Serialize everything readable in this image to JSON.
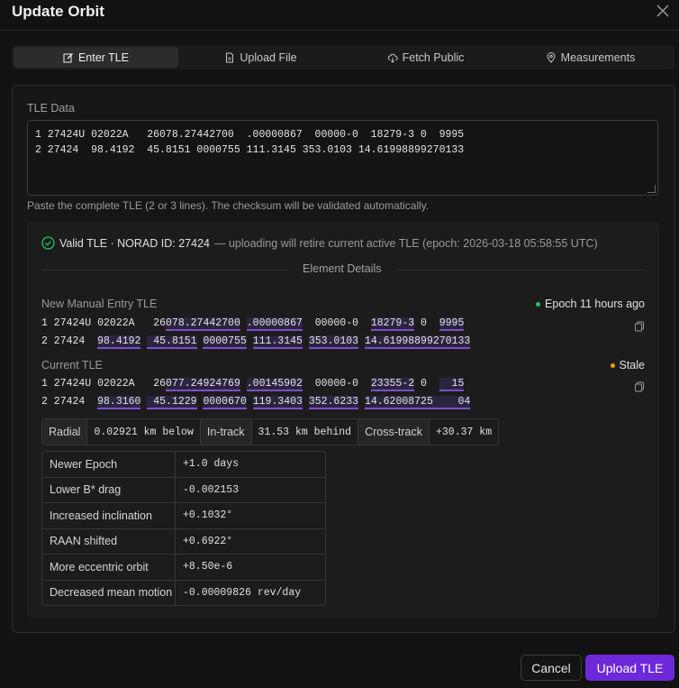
{
  "dialog": {
    "title": "Update Orbit"
  },
  "tabs": [
    {
      "label": "Enter TLE",
      "icon": "edit-icon"
    },
    {
      "label": "Upload File",
      "icon": "file-icon"
    },
    {
      "label": "Fetch Public",
      "icon": "cloud-download-icon"
    },
    {
      "label": "Measurements",
      "icon": "map-pin-icon"
    }
  ],
  "tle_input": {
    "label": "TLE Data",
    "line1": "1 27424U 02022A   26078.27442700  .00000867  00000-0  18279-3 0  9995",
    "line2": "2 27424  98.4192  45.8151 0000755 111.3145 353.0103 14.61998899270133",
    "helper": "Paste the complete TLE (2 or 3 lines). The checksum will be validated automatically."
  },
  "validation": {
    "status": "Valid TLE · NORAD ID: 27424",
    "detail": "— uploading will retire current active TLE (epoch: 2026-03-18 05:58:55 UTC)"
  },
  "element_details": {
    "title": "Element Details",
    "new": {
      "label": "New Manual Entry TLE",
      "status": "Epoch 11 hours ago",
      "status_color": "#22c55e",
      "line1_parts": [
        "1 27424U 02022A   26",
        "078.27442700",
        " ",
        ".00000867",
        "  00000-0  ",
        "18279-3",
        " 0  ",
        "9995"
      ],
      "line2_parts": [
        "2 27424  ",
        "98.4192",
        " ",
        " 45.8151",
        " ",
        "0000755",
        " ",
        "111.3145",
        " ",
        "353.0103",
        " ",
        "14.61998899270133"
      ]
    },
    "current": {
      "label": "Current TLE",
      "status": "Stale",
      "status_color": "#f59e0b",
      "line1_parts": [
        "1 27424U 02022A   26",
        "077.24924769",
        " ",
        ".00145902",
        "  00000-0  ",
        "23355-2",
        " 0  ",
        "  15"
      ],
      "line2_parts": [
        "2 27424  ",
        "98.3160",
        " ",
        " 45.1229",
        " ",
        "0000670",
        " ",
        "119.3403",
        " ",
        "352.6233",
        " ",
        "14.62008725    04"
      ]
    }
  },
  "position_deltas": [
    {
      "label": "Radial",
      "value": "0.02921 km below"
    },
    {
      "label": "In-track",
      "value": "31.53 km behind"
    },
    {
      "label": "Cross-track",
      "value": "+30.37 km"
    }
  ],
  "element_changes": [
    {
      "label": "Newer Epoch",
      "value": "+1.0 days"
    },
    {
      "label": "Lower B* drag",
      "value": "-0.002153"
    },
    {
      "label": "Increased inclination",
      "value": "+0.1032°"
    },
    {
      "label": "RAAN shifted",
      "value": "+0.6922°"
    },
    {
      "label": "More eccentric orbit",
      "value": "+8.50e-6"
    },
    {
      "label": "Decreased mean motion",
      "value": "-0.00009826 rev/day"
    }
  ],
  "actions": {
    "cancel": "Cancel",
    "submit": "Upload TLE"
  },
  "colors": {
    "accent": "#6d28d9",
    "valid": "#22c55e",
    "stale": "#f59e0b",
    "highlight": "#7c4dcc"
  }
}
